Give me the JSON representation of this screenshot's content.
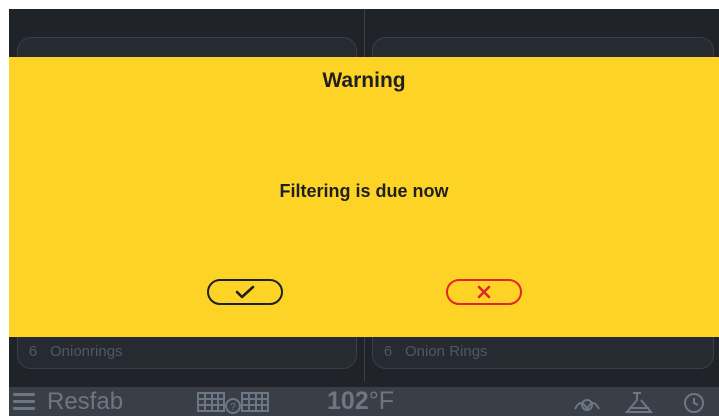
{
  "dialog": {
    "title": "Warning",
    "message": "Filtering is due now",
    "confirm_icon": "checkmark-icon",
    "cancel_icon": "x-icon",
    "background_color": "#fdd425",
    "cancel_color": "#e4232a"
  },
  "background_panels": {
    "left": {
      "bottom_item": {
        "index": "6",
        "label": "Onionrings"
      }
    },
    "right": {
      "bottom_item": {
        "index": "6",
        "label": "Onion Rings"
      }
    }
  },
  "status_bar": {
    "brand": "Resfab",
    "temperature": "102",
    "temperature_unit": "°F",
    "icons": [
      "menu-icon",
      "basket-icon",
      "oil-icon",
      "flask-icon",
      "clock-icon"
    ]
  }
}
